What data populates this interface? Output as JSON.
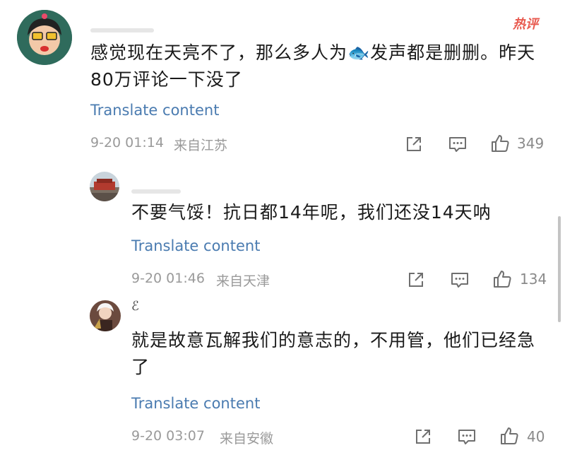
{
  "hot_badge": "热评",
  "comments": [
    {
      "text": "感觉现在天亮不了，那么多人为🐟发声都是删删。昨天80万评论一下没了",
      "translate": "Translate content",
      "date": "9-20 01:14",
      "location": "来自江苏",
      "likes": "349"
    },
    {
      "text": "不要气馁！抗日都14年呢，我们还没14天呐",
      "translate": "Translate content",
      "date": "9-20 01:46",
      "location": "来自天津",
      "likes": "134"
    },
    {
      "username": "ℰ",
      "text": "就是故意瓦解我们的意志的，不用管，他们已经急了",
      "translate": "Translate content",
      "date": "9-20 03:07",
      "location": "来自安徽",
      "likes": "40"
    }
  ],
  "icons": [
    "share-icon",
    "comment-icon",
    "like-icon"
  ]
}
